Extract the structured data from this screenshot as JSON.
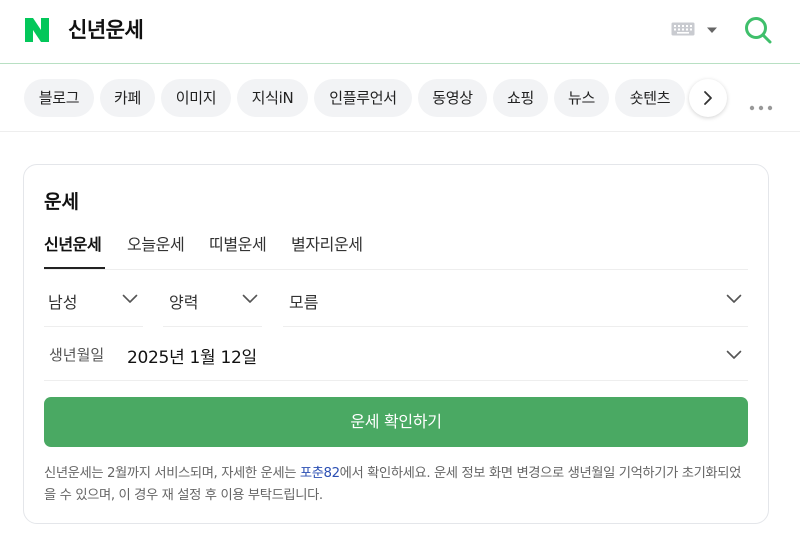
{
  "header": {
    "query": "신년운세",
    "colors": {
      "brand_green": "#03c75a",
      "search_green": "#3fbf6b"
    },
    "icons": {
      "logo": "naver-n-logo",
      "keyboard": "keyboard-icon",
      "caret": "caret-down-icon",
      "search": "search-icon"
    }
  },
  "nav": {
    "tabs": [
      {
        "label": "블로그"
      },
      {
        "label": "카페"
      },
      {
        "label": "이미지"
      },
      {
        "label": "지식iN"
      },
      {
        "label": "인플루언서"
      },
      {
        "label": "동영상"
      },
      {
        "label": "쇼핑"
      },
      {
        "label": "뉴스"
      },
      {
        "label": "숏텐츠"
      }
    ],
    "icons": {
      "next": "chevron-right-icon",
      "more": "more-dots-icon"
    }
  },
  "fortune": {
    "title": "운세",
    "tabs": [
      {
        "label": "신년운세",
        "active": true
      },
      {
        "label": "오늘운세",
        "active": false
      },
      {
        "label": "띠별운세",
        "active": false
      },
      {
        "label": "별자리운세",
        "active": false
      }
    ],
    "gender": {
      "value": "남성"
    },
    "calendar": {
      "value": "양력"
    },
    "birth_time": {
      "value": "모름"
    },
    "birthdate": {
      "label": "생년월일",
      "value": "2025년 1월 12일"
    },
    "confirm_label": "운세 확인하기",
    "notice": {
      "before": "신년운세는 2월까지 서비스되며, 자세한 운세는 ",
      "link": "포춘82",
      "after": "에서 확인하세요. 운세 정보 화면 변경으로 생년월일 기억하기가 초기화되었을 수 있으며, 이 경우 재 설정 후 이용 부탁드립니다."
    },
    "colors": {
      "button_green": "#4aa963",
      "link_blue": "#2b4fb3"
    }
  }
}
